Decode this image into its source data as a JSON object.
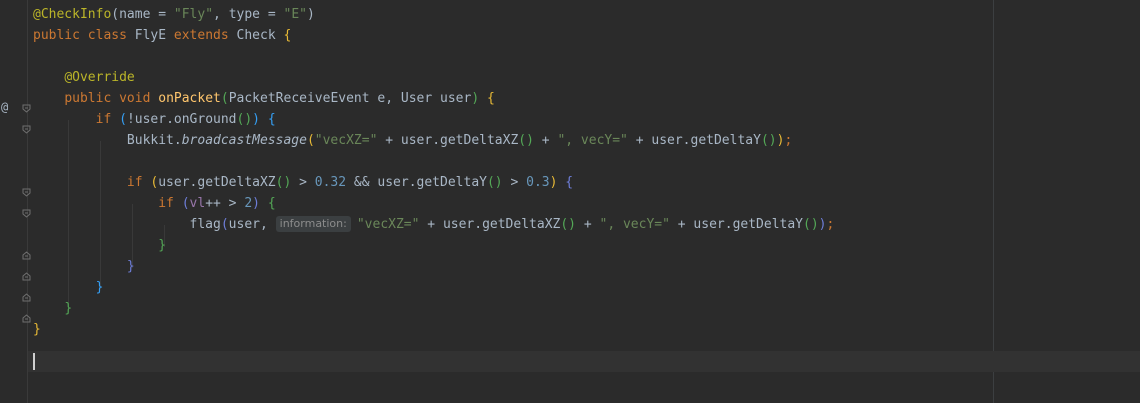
{
  "editor": {
    "gutter_marker": "@",
    "lines": [
      {
        "id": "l1",
        "tokens": [
          {
            "t": "@CheckInfo",
            "c": "annot"
          },
          {
            "t": "(",
            "c": ""
          },
          {
            "t": "name",
            "c": ""
          },
          {
            "t": " = ",
            "c": ""
          },
          {
            "t": "\"Fly\"",
            "c": "str"
          },
          {
            "t": ", ",
            "c": ""
          },
          {
            "t": "type",
            "c": ""
          },
          {
            "t": " = ",
            "c": ""
          },
          {
            "t": "\"E\"",
            "c": "str"
          },
          {
            "t": ")",
            "c": ""
          }
        ]
      },
      {
        "id": "l2",
        "tokens": [
          {
            "t": "public",
            "c": "kw"
          },
          {
            "t": " ",
            "c": ""
          },
          {
            "t": "class",
            "c": "kw"
          },
          {
            "t": " FlyE ",
            "c": ""
          },
          {
            "t": "extends",
            "c": "kw"
          },
          {
            "t": " Check ",
            "c": ""
          },
          {
            "t": "{",
            "c": "b1"
          }
        ]
      },
      {
        "id": "l3",
        "tokens": []
      },
      {
        "id": "l4",
        "tokens": [
          {
            "t": "    ",
            "c": ""
          },
          {
            "t": "@Override",
            "c": "annot"
          }
        ]
      },
      {
        "id": "l5",
        "tokens": [
          {
            "t": "    ",
            "c": ""
          },
          {
            "t": "public",
            "c": "kw"
          },
          {
            "t": " ",
            "c": ""
          },
          {
            "t": "void",
            "c": "kw"
          },
          {
            "t": " ",
            "c": ""
          },
          {
            "t": "onPacket",
            "c": "fn"
          },
          {
            "t": "(",
            "c": "b2"
          },
          {
            "t": "PacketReceiveEvent e, User user",
            "c": ""
          },
          {
            "t": ")",
            "c": "b2"
          },
          {
            "t": " ",
            "c": ""
          },
          {
            "t": "{",
            "c": "b1"
          }
        ]
      },
      {
        "id": "l6",
        "tokens": [
          {
            "t": "        ",
            "c": ""
          },
          {
            "t": "if",
            "c": "kw"
          },
          {
            "t": " ",
            "c": ""
          },
          {
            "t": "(",
            "c": "b3"
          },
          {
            "t": "!user.onGround",
            "c": ""
          },
          {
            "t": "()",
            "c": "b2"
          },
          {
            "t": ")",
            "c": "b3"
          },
          {
            "t": " ",
            "c": ""
          },
          {
            "t": "{",
            "c": "b3"
          }
        ]
      },
      {
        "id": "l7",
        "tokens": [
          {
            "t": "            Bukkit.",
            "c": ""
          },
          {
            "t": "broadcastMessage",
            "c": "italic"
          },
          {
            "t": "(",
            "c": "b1"
          },
          {
            "t": "\"vecXZ=\"",
            "c": "str"
          },
          {
            "t": " + user.getDeltaXZ",
            "c": ""
          },
          {
            "t": "()",
            "c": "b2"
          },
          {
            "t": " + ",
            "c": ""
          },
          {
            "t": "\", vecY=\"",
            "c": "str"
          },
          {
            "t": " + user.getDeltaY",
            "c": ""
          },
          {
            "t": "()",
            "c": "b2"
          },
          {
            "t": ")",
            "c": "b1"
          },
          {
            "t": ";",
            "c": "kw"
          }
        ]
      },
      {
        "id": "l8",
        "tokens": []
      },
      {
        "id": "l9",
        "tokens": [
          {
            "t": "            ",
            "c": ""
          },
          {
            "t": "if",
            "c": "kw"
          },
          {
            "t": " ",
            "c": ""
          },
          {
            "t": "(",
            "c": "b1"
          },
          {
            "t": "user.getDeltaXZ",
            "c": ""
          },
          {
            "t": "()",
            "c": "b2"
          },
          {
            "t": " > ",
            "c": ""
          },
          {
            "t": "0.32",
            "c": "num"
          },
          {
            "t": " && user.getDeltaY",
            "c": ""
          },
          {
            "t": "()",
            "c": "b2"
          },
          {
            "t": " > ",
            "c": ""
          },
          {
            "t": "0.3",
            "c": "num"
          },
          {
            "t": ")",
            "c": "b1"
          },
          {
            "t": " ",
            "c": ""
          },
          {
            "t": "{",
            "c": "b4"
          }
        ]
      },
      {
        "id": "l10",
        "tokens": [
          {
            "t": "                ",
            "c": ""
          },
          {
            "t": "if",
            "c": "kw"
          },
          {
            "t": " ",
            "c": ""
          },
          {
            "t": "(",
            "c": "b4"
          },
          {
            "t": "vl",
            "c": "field"
          },
          {
            "t": "++ > ",
            "c": ""
          },
          {
            "t": "2",
            "c": "num"
          },
          {
            "t": ")",
            "c": "b4"
          },
          {
            "t": " ",
            "c": ""
          },
          {
            "t": "{",
            "c": "b2"
          }
        ]
      },
      {
        "id": "l11",
        "tokens": [
          {
            "t": "                    flag",
            "c": ""
          },
          {
            "t": "(",
            "c": "b4"
          },
          {
            "t": "user, ",
            "c": ""
          },
          {
            "t": "information:",
            "c": "inlay"
          },
          {
            "t": "\"vecXZ=\"",
            "c": "str"
          },
          {
            "t": " + user.getDeltaXZ",
            "c": ""
          },
          {
            "t": "()",
            "c": "b2"
          },
          {
            "t": " + ",
            "c": ""
          },
          {
            "t": "\", vecY=\"",
            "c": "str"
          },
          {
            "t": " + user.getDeltaY",
            "c": ""
          },
          {
            "t": "()",
            "c": "b2"
          },
          {
            "t": ")",
            "c": "b4"
          },
          {
            "t": ";",
            "c": "kw"
          }
        ]
      },
      {
        "id": "l12",
        "tokens": [
          {
            "t": "                ",
            "c": ""
          },
          {
            "t": "}",
            "c": "b2"
          }
        ]
      },
      {
        "id": "l13",
        "tokens": [
          {
            "t": "            ",
            "c": ""
          },
          {
            "t": "}",
            "c": "b4"
          }
        ]
      },
      {
        "id": "l14",
        "tokens": [
          {
            "t": "        ",
            "c": ""
          },
          {
            "t": "}",
            "c": "b3"
          }
        ]
      },
      {
        "id": "l15",
        "tokens": [
          {
            "t": "    ",
            "c": ""
          },
          {
            "t": "}",
            "c": "b2"
          }
        ]
      },
      {
        "id": "l16",
        "tokens": [
          {
            "t": "}",
            "c": "b1"
          }
        ]
      },
      {
        "id": "l17",
        "tokens": []
      }
    ]
  },
  "colors": {
    "background": "#2b2b2b",
    "keyword": "#cc7832",
    "annotation": "#bbb529",
    "method": "#ffc66d",
    "string": "#6a8759",
    "number": "#6897bb",
    "text": "#a9b7c6"
  }
}
